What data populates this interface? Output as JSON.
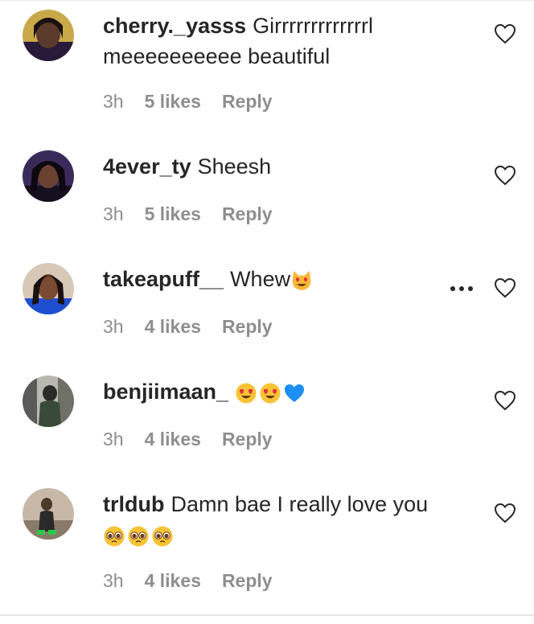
{
  "comments": [
    {
      "username": "cherry._yasss",
      "text": "Girrrrrrrrrrrrrl meeeeeeeeee beautiful",
      "emojis": [],
      "time": "3h",
      "likes": "5 likes",
      "reply": "Reply",
      "avatar_color": "#c9a84a"
    },
    {
      "username": "4ever_ty",
      "text": "Sheesh",
      "emojis": [],
      "time": "3h",
      "likes": "5 likes",
      "reply": "Reply",
      "avatar_color": "#3a2a5a"
    },
    {
      "username": "takeapuff__",
      "text": "Whew",
      "emojis": [
        "heart-eyes-cat"
      ],
      "time": "3h",
      "likes": "4 likes",
      "reply": "Reply",
      "avatar_color": "#1e4fd0"
    },
    {
      "username": "benjiimaan_",
      "text": "",
      "emojis": [
        "heart-eyes",
        "heart-eyes",
        "blue-heart"
      ],
      "time": "3h",
      "likes": "4 likes",
      "reply": "Reply",
      "avatar_color": "#4a5a4a"
    },
    {
      "username": "trldub",
      "text": "Damn bae I really love you",
      "emojis": [
        "pleading-face",
        "pleading-face",
        "pleading-face"
      ],
      "time": "3h",
      "likes": "4 likes",
      "reply": "Reply",
      "avatar_color": "#7a6a5a"
    }
  ],
  "icons": {
    "like": "heart-outline-icon",
    "more": "more-options-icon"
  },
  "colors": {
    "text": "#262626",
    "meta": "#8e8e8e",
    "divider": "#e6e6e6"
  }
}
